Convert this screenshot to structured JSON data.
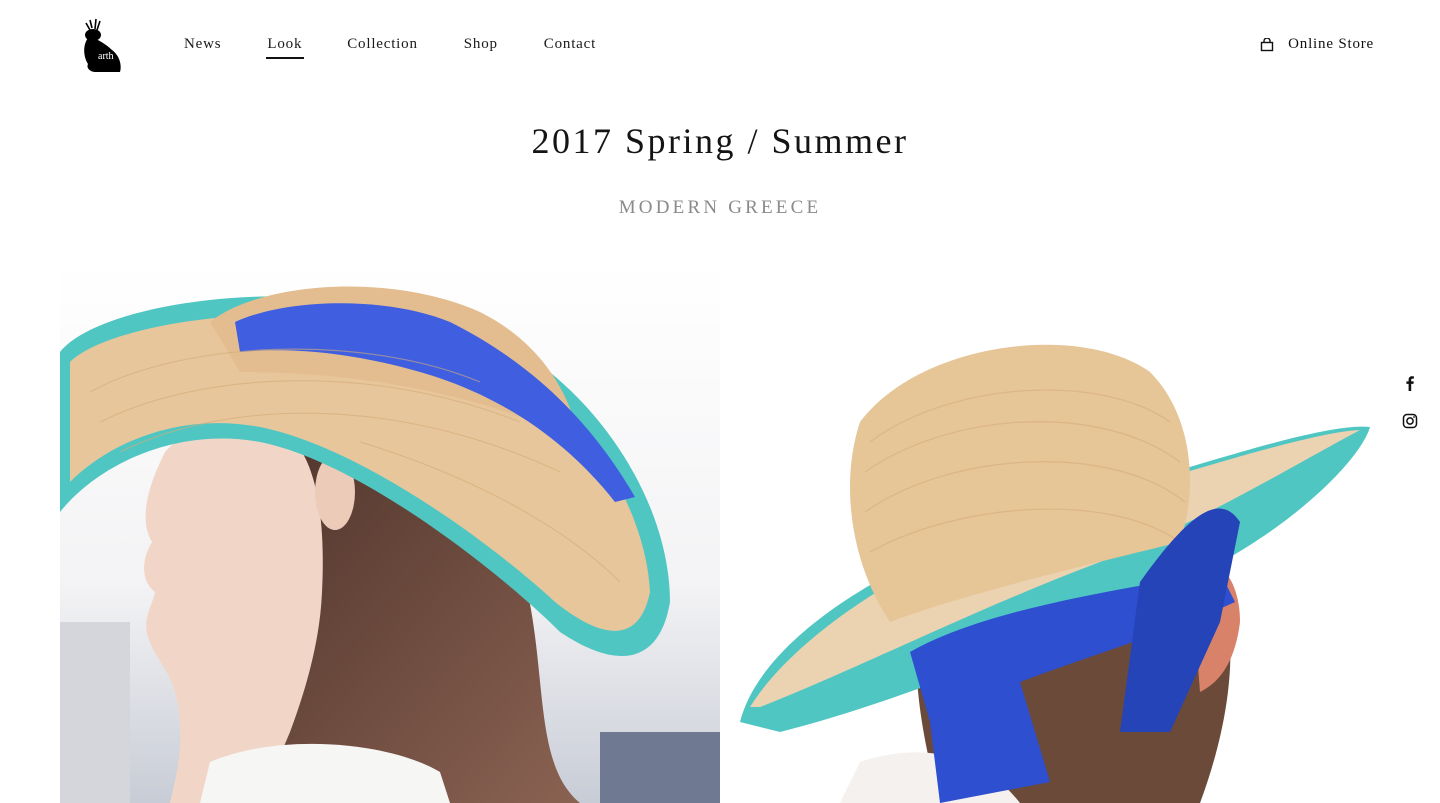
{
  "brand": {
    "logo_text": "arth",
    "logo_icon": "jackalope-rabbit-icon"
  },
  "nav": {
    "items": [
      {
        "label": "News",
        "active": false
      },
      {
        "label": "Look",
        "active": true
      },
      {
        "label": "Collection",
        "active": false
      },
      {
        "label": "Shop",
        "active": false
      },
      {
        "label": "Contact",
        "active": false
      }
    ]
  },
  "header": {
    "online_store_label": "Online Store",
    "online_store_icon": "shopping-bag-icon"
  },
  "page": {
    "title": "2017 Spring / Summer",
    "subtitle": "MODERN GREECE"
  },
  "gallery": {
    "images": [
      {
        "subject": "woman-in-straw-boater-hat-profile"
      },
      {
        "subject": "woman-in-straw-boater-hat-back-view"
      }
    ]
  },
  "social": {
    "icons": [
      "facebook-icon",
      "instagram-icon"
    ]
  },
  "colors": {
    "text": "#141414",
    "subtitle": "#8a8a8a",
    "hat_straw": "#e3c49a",
    "hat_brim_teal": "#4fc6c2",
    "ribbon_blue": "#2d4fd0",
    "hair_brown": "#6b4a3a"
  }
}
